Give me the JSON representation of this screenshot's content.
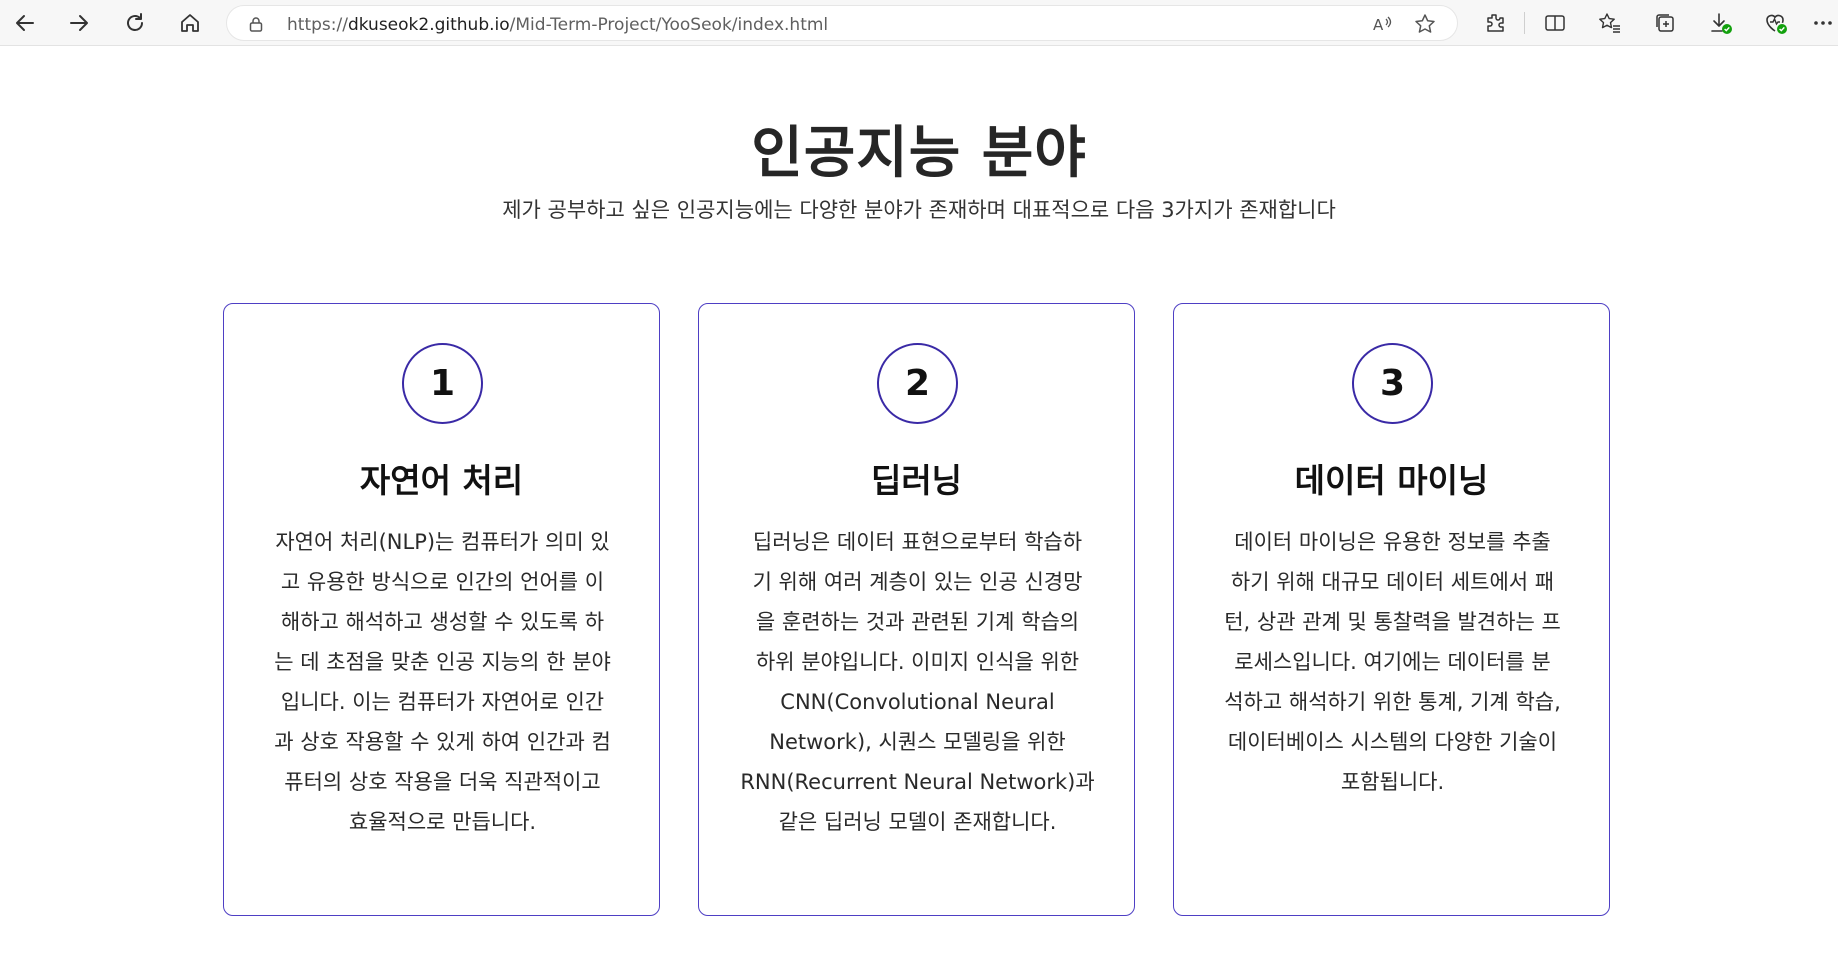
{
  "browser": {
    "url_prefix": "https://",
    "url_host": "dkuseok2.github.io",
    "url_path": "/Mid-Term-Project/YooSeok/index.html",
    "icons": [
      "back-icon",
      "forward-icon",
      "refresh-icon",
      "home-icon",
      "lock-icon",
      "read-aloud-icon",
      "favorite-star-icon",
      "extensions-icon",
      "split-screen-icon",
      "favorites-icon",
      "collections-icon",
      "downloads-icon",
      "browser-essentials-icon",
      "more-icon"
    ]
  },
  "page": {
    "title": "인공지능 분야",
    "subtitle": "제가 공부하고 싶은 인공지능에는 다양한 분야가 존재하며 대표적으로 다음 3가지가 존재합니다"
  },
  "cards": [
    {
      "number": "1",
      "title": "자연어 처리",
      "lines": [
        "자연어 처리(NLP)는 컴퓨터가 의미 있",
        "고 유용한 방식으로 인간의 언어를 이",
        "해하고 해석하고 생성할 수 있도록 하",
        "는 데 초점을 맞춘 인공 지능의 한 분야",
        "입니다.  이는 컴퓨터가 자연어로 인간",
        "과 상호 작용할 수 있게 하여 인간과 컴",
        "퓨터의 상호 작용을 더욱 직관적이고",
        "효율적으로 만듭니다."
      ]
    },
    {
      "number": "2",
      "title": "딥러닝",
      "lines": [
        "딥러닝은 데이터 표현으로부터 학습하",
        "기 위해 여러 계층이 있는 인공 신경망",
        "을 훈련하는 것과 관련된 기계 학습의",
        "하위 분야입니다.  이미지 인식을 위한",
        "CNN(Convolutional Neural",
        "Network), 시퀀스 모델링을 위한",
        "RNN(Recurrent Neural Network)과",
        "같은 딥러닝 모델이 존재합니다."
      ]
    },
    {
      "number": "3",
      "title": "데이터 마이닝",
      "lines": [
        "데이터 마이닝은 유용한 정보를 추출",
        "하기 위해 대규모 데이터 세트에서 패",
        "턴, 상관 관계 및 통찰력을 발견하는 프",
        "로세스입니다.  여기에는 데이터를 분",
        "석하고 해석하기 위한 통계, 기계 학습,",
        "데이터베이스 시스템의 다양한 기술이",
        "포함됩니다."
      ]
    }
  ],
  "colors": {
    "accent": "#3a2aa6",
    "card_border": "#4e3fc4",
    "text": "#2a2a2a"
  }
}
